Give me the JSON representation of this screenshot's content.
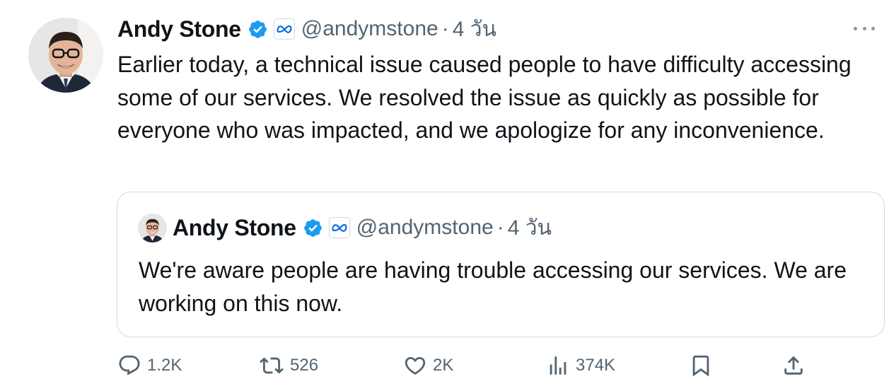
{
  "tweet": {
    "author_name": "Andy Stone",
    "handle": "@andymstone",
    "separator": "·",
    "time": "4 วัน",
    "text": "Earlier today, a technical issue caused people to have difficulty accessing some of our services. We resolved the issue as quickly as possible for everyone who was impacted, and we apologize for any inconvenience.",
    "verified_color": "#1d9bf0",
    "affiliation_badge_icon": "meta-logo-icon",
    "more_icon": "ellipsis-icon"
  },
  "quoted_tweet": {
    "author_name": "Andy Stone",
    "handle": "@andymstone",
    "separator": "·",
    "time": "4 วัน",
    "text": "We're aware people are having trouble accessing our services. We are working on this now."
  },
  "actions": {
    "replies": {
      "icon": "reply-icon",
      "count": "1.2K"
    },
    "reposts": {
      "icon": "repost-icon",
      "count": "526"
    },
    "likes": {
      "icon": "heart-icon",
      "count": "2K"
    },
    "views": {
      "icon": "views-icon",
      "count": "374K"
    },
    "bookmark": {
      "icon": "bookmark-icon"
    },
    "share": {
      "icon": "share-icon"
    }
  },
  "colors": {
    "text_primary": "#0f1419",
    "text_secondary": "#536471",
    "border": "#cfd9de",
    "meta_blue": "#0668e1"
  }
}
